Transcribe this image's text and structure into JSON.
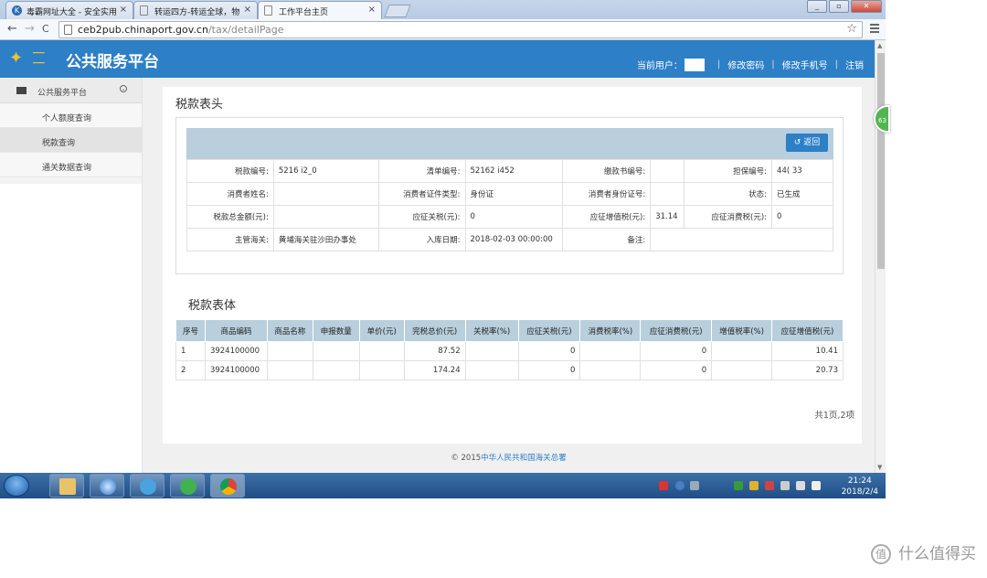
{
  "browser": {
    "tabs": [
      {
        "title": "毒霸网址大全 - 安全实用",
        "close": "×"
      },
      {
        "title": "转运四方-转运全球，物",
        "close": "×"
      },
      {
        "title": "工作平台主页",
        "close": "×"
      }
    ],
    "url_host": "ceb2pub.chinaport.gov.cn",
    "url_path": "/tax/detailPage",
    "star": "☆",
    "back": "←",
    "forward": "→",
    "reload": "C"
  },
  "header": {
    "title": "公共服务平台",
    "current_user_label": "当前用户：",
    "change_password": "修改密码",
    "change_phone": "修改手机号",
    "logout": "注销",
    "separator": "|"
  },
  "sidebar": {
    "section": "公共服务平台",
    "items": [
      {
        "label": "个人额度查询"
      },
      {
        "label": "税款查询"
      },
      {
        "label": "通关数据查询"
      }
    ]
  },
  "tax_header": {
    "title": "税款表头",
    "back_button": "返回",
    "rows": [
      [
        "税款编号:",
        "5216        i2_0",
        "清单编号:",
        "52162        i452",
        "缴款书编号:",
        "",
        "担保编号:",
        "44(        33"
      ],
      [
        "消费者姓名:",
        "",
        "消费者证件类型:",
        "身份证",
        "消费者身份证号:",
        "",
        "状态:",
        "已生成"
      ],
      [
        "税款总金额(元):",
        "",
        "应征关税(元):",
        "0",
        "应征增值税(元):",
        "31.14",
        "应征消费税(元):",
        "0"
      ],
      [
        "主管海关:",
        "黄埔海关驻沙田办事处",
        "入库日期:",
        "2018-02-03 00:00:00",
        "备注:",
        ""
      ]
    ]
  },
  "tax_body": {
    "title": "税款表体",
    "columns": [
      "序号",
      "商品编码",
      "商品名称",
      "申报数量",
      "单价(元)",
      "完税总价(元)",
      "关税率(%)",
      "应征关税(元)",
      "消费税率(%)",
      "应征消费税(元)",
      "增值税率(%)",
      "应征增值税(元)"
    ],
    "rows": [
      [
        "1",
        "3924100000",
        "",
        "",
        "",
        "87.52",
        "",
        "0",
        "",
        "0",
        "",
        "10.41"
      ],
      [
        "2",
        "3924100000",
        "",
        "",
        "",
        "174.24",
        "",
        "0",
        "",
        "0",
        "",
        "20.73"
      ]
    ],
    "pager": "共1页,2项"
  },
  "footer": {
    "copyright": "© 2015",
    "org": "中华人民共和国海关总署"
  },
  "badge": "63",
  "taskbar": {
    "time": "21:24",
    "date": "2018/2/4"
  },
  "watermark": "什么值得买",
  "watermark_glyph": "值"
}
